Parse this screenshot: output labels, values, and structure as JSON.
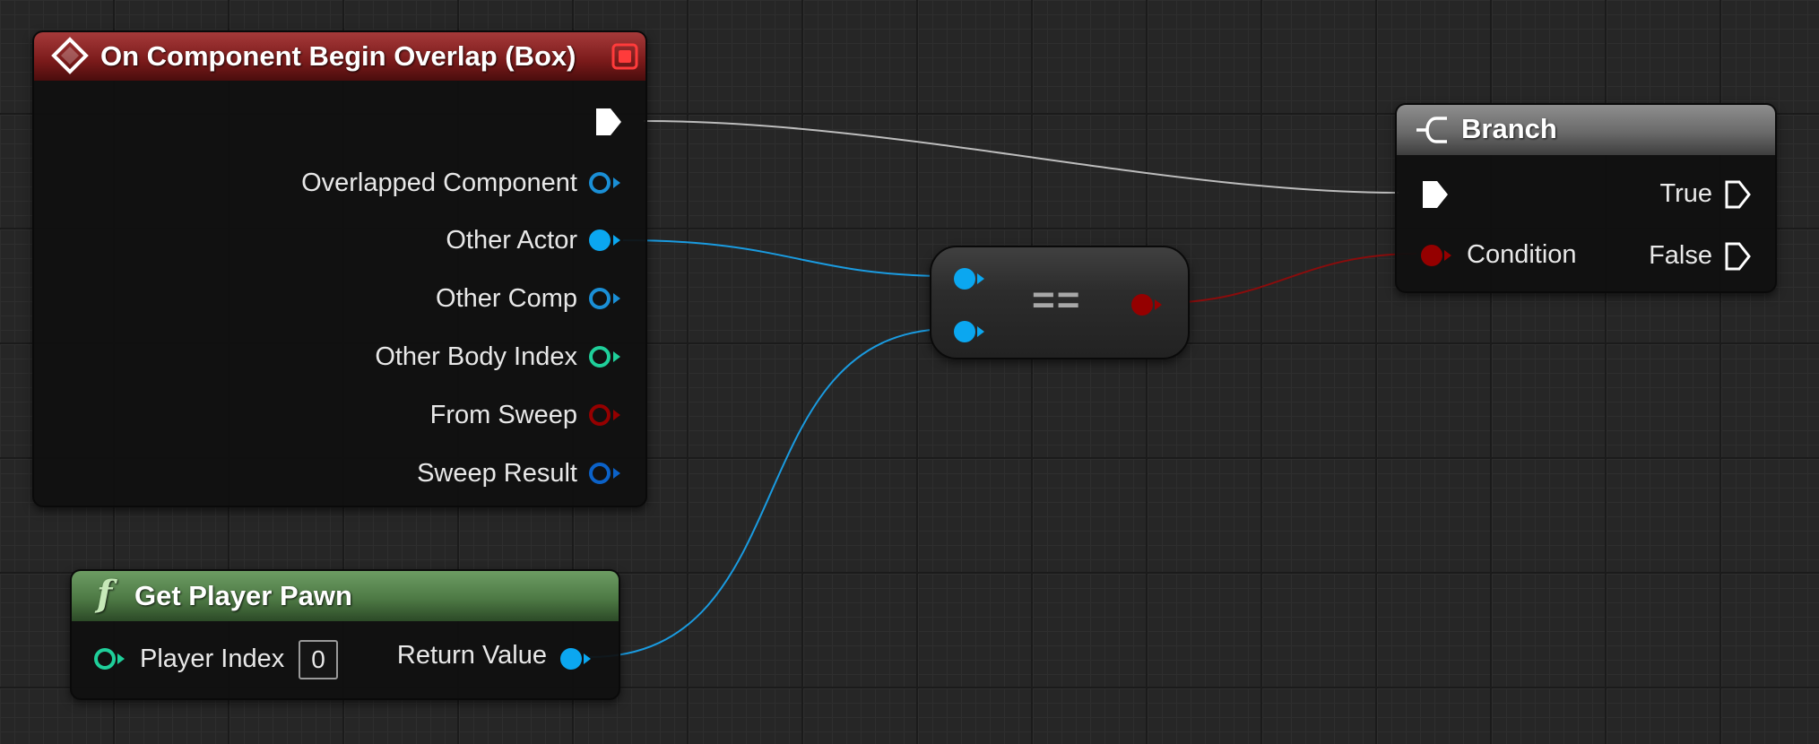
{
  "event_node": {
    "title": "On Component Begin Overlap (Box)",
    "pins": {
      "overlapped_component": "Overlapped Component",
      "other_actor": "Other Actor",
      "other_comp": "Other Comp",
      "other_body_index": "Other Body Index",
      "from_sweep": "From Sweep",
      "sweep_result": "Sweep Result"
    }
  },
  "branch_node": {
    "title": "Branch",
    "pins": {
      "true": "True",
      "false": "False",
      "condition": "Condition"
    }
  },
  "compare_node": {
    "operator": "=="
  },
  "get_player_pawn_node": {
    "title": "Get Player Pawn",
    "func_glyph": "f",
    "pins": {
      "player_index": "Player Index",
      "player_index_value": "0",
      "return_value": "Return Value"
    }
  },
  "colors": {
    "exec": "#ffffff",
    "object": "#0ba7f0",
    "object_dark": "#0c4f87",
    "component": "#1a8fd6",
    "int": "#1fcf9a",
    "bool": "#950000",
    "struct": "#0b62c9",
    "wire_exec": "#bdbdbd",
    "wire_object": "#1a9be0",
    "wire_bool": "#8a0c0c"
  },
  "icons": {
    "event_icon": "diamond-icon",
    "event_delegate": "red-square-icon",
    "branch_icon": "branch-icon",
    "function_icon": "function-icon"
  }
}
